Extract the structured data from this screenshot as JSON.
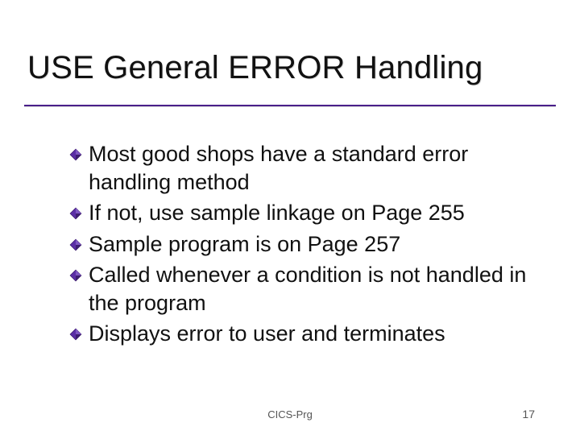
{
  "slide": {
    "title": "USE General ERROR Handling",
    "bullets": [
      "Most good shops have a standard error handling method",
      "If not, use sample linkage on Page 255",
      "Sample program is on Page 257",
      "Called whenever a condition is not handled in the program",
      "Displays error to user and terminates"
    ],
    "footer_center": "CICS-Prg",
    "page_number": "17"
  },
  "colors": {
    "accent": "#4a1f8a",
    "bullet_fill": "#5b2ea6",
    "bullet_edge": "#2e0f5e"
  }
}
